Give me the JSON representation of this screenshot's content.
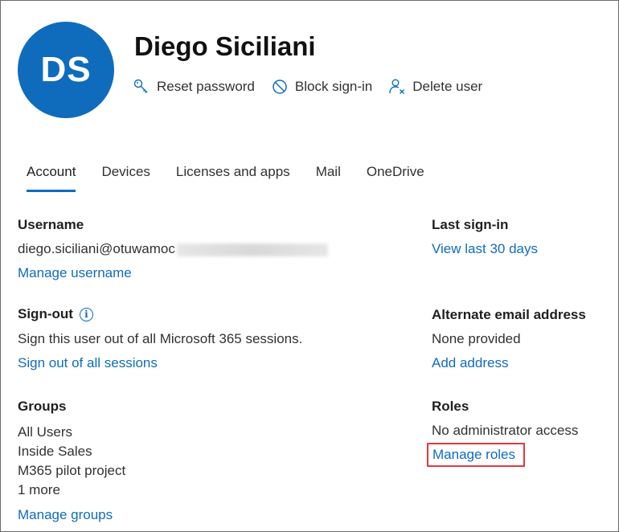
{
  "user": {
    "initials": "DS",
    "display_name": "Diego Siciliani",
    "avatar_color": "#0F6CBD"
  },
  "actions": [
    {
      "label": "Reset password",
      "icon": "key-icon"
    },
    {
      "label": "Block sign-in",
      "icon": "block-icon"
    },
    {
      "label": "Delete user",
      "icon": "delete-user-icon"
    }
  ],
  "tabs": [
    {
      "label": "Account",
      "active": true
    },
    {
      "label": "Devices",
      "active": false
    },
    {
      "label": "Licenses and apps",
      "active": false
    },
    {
      "label": "Mail",
      "active": false
    },
    {
      "label": "OneDrive",
      "active": false
    }
  ],
  "username": {
    "label": "Username",
    "value": "diego.siciliani@otuwamoc",
    "link": "Manage username"
  },
  "signout": {
    "label": "Sign-out",
    "text": "Sign this user out of all Microsoft 365 sessions.",
    "link": "Sign out of all sessions"
  },
  "groups": {
    "label": "Groups",
    "items": [
      "All Users",
      "Inside Sales",
      "M365 pilot project",
      "1 more"
    ],
    "link": "Manage groups"
  },
  "last_signin": {
    "label": "Last sign-in",
    "link": "View last 30 days"
  },
  "alt_email": {
    "label": "Alternate email address",
    "value": "None provided",
    "link": "Add address"
  },
  "roles": {
    "label": "Roles",
    "value": "No administrator access",
    "link": "Manage roles"
  },
  "colors": {
    "link": "#0F6CBD",
    "highlight": "#E0393E"
  }
}
